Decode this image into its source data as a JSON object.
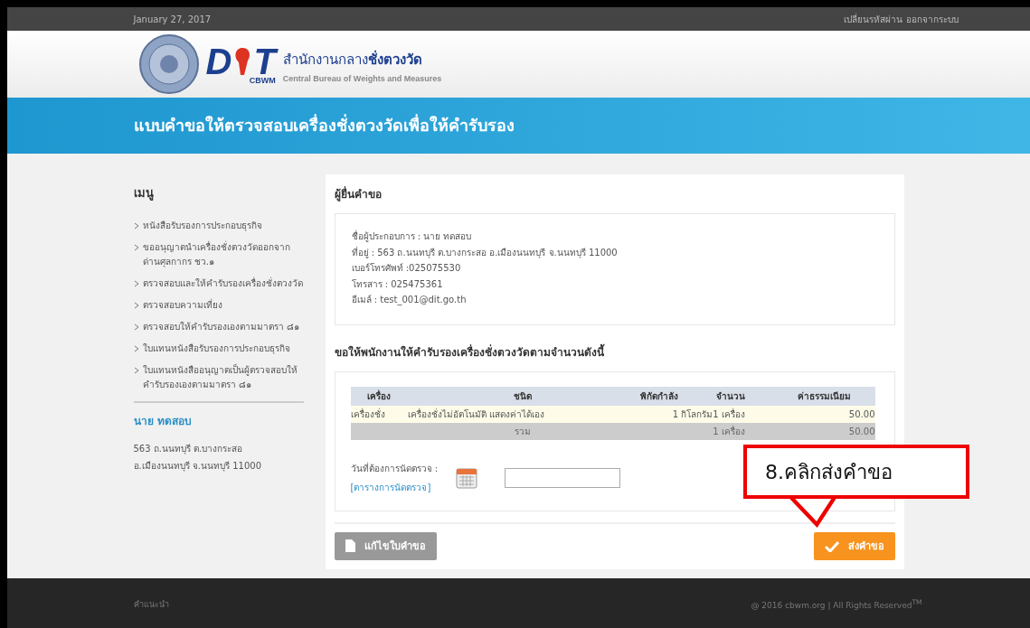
{
  "top_bar": {
    "date": "January 27, 2017",
    "links": [
      "เปลี่ยนรหัสผ่าน",
      "ออกจากระบบ"
    ]
  },
  "header": {
    "logo": {
      "left": "D",
      "right": "T",
      "sub": "CBWM"
    },
    "org_name_thai": "สำนักงานกลาง**ชั่งตวงวัด**",
    "org_name_english": "Central Bureau of Weights and Measures"
  },
  "banner": {
    "title": "แบบคำขอให้ตรวจสอบเครื่องชั่งตวงวัดเพื่อให้คำรับรอง"
  },
  "sidebar": {
    "heading": "เมนู",
    "items": [
      {
        "label": "หนังสือรับรองการประกอบธุรกิจ"
      },
      {
        "label": "ขออนุญาตนำเครื่องชั่งตวงวัดออกจากด่านศุลกากร ชว.๑"
      },
      {
        "label": "ตรวจสอบและให้คำรับรองเครื่องชั่งตวงวัด"
      },
      {
        "label": "ตรวจสอบความเที่ยง"
      },
      {
        "label": "ตรวจสอบให้คำรับรองเองตามมาตรา ๘๑"
      },
      {
        "label": "ใบแทนหนังสือรับรองการประกอบธุรกิจ"
      },
      {
        "label": "ใบแทนหนังสืออนุญาตเป็นผู้ตรวจสอบให้คำรับรองเองตามมาตรา ๘๑"
      }
    ],
    "user_name": "นาย ทดสอบ",
    "user_address": [
      "563 ถ.นนทบุรี ต.บางกระสอ",
      "อ.เมืองนนทบุรี จ.นนทบุรี 11000"
    ]
  },
  "applicant": {
    "heading": "ผู้ยื่นคำขอ",
    "lines": [
      "ชื่อผู้ประกอบการ : นาย ทดสอบ",
      "ที่อยู่ : 563 ถ.นนทบุรี ต.บางกระสอ อ.เมืองนนทบุรี จ.นนทบุรี 11000",
      "เบอร์โทรศัพท์ :025075530",
      "โทรสาร : 025475361",
      "อีเมล์ : test_001@dit.go.th"
    ]
  },
  "request": {
    "heading": "ขอให้พนักงานให้คำรับรองเครื่องชั่งตวงวัดตามจำนวนดังนี้",
    "table": {
      "columns": [
        "เครื่อง",
        "ชนิด",
        "พิกัดกำลัง",
        "จำนวน",
        "ค่าธรรมเนียม"
      ],
      "rows": [
        {
          "kind": "item",
          "cells": [
            "เครื่องชั่ง",
            "เครื่องชั่งไม่อัตโนมัติ แสดงค่าได้เอง",
            "1 กิโลกรัม",
            "1 เครื่อง",
            "50.00"
          ]
        },
        {
          "kind": "total",
          "cells": [
            "",
            "รวม",
            "",
            "1 เครื่อง",
            "50.00"
          ]
        }
      ]
    },
    "date_label": "วันที่ต้องการนัดตรวจ :",
    "schedule_link": "[ตารางการนัดตรวจ]"
  },
  "buttons": {
    "edit": "แก้ไขใบคำขอ",
    "submit": "ส่งคำขอ"
  },
  "callout": {
    "text": "8.คลิกส่งคำขอ"
  },
  "footer": {
    "left": "คำแนะนำ",
    "right": "@ 2016 cbwm.org | All Rights Reserved",
    "mark": "TM"
  }
}
